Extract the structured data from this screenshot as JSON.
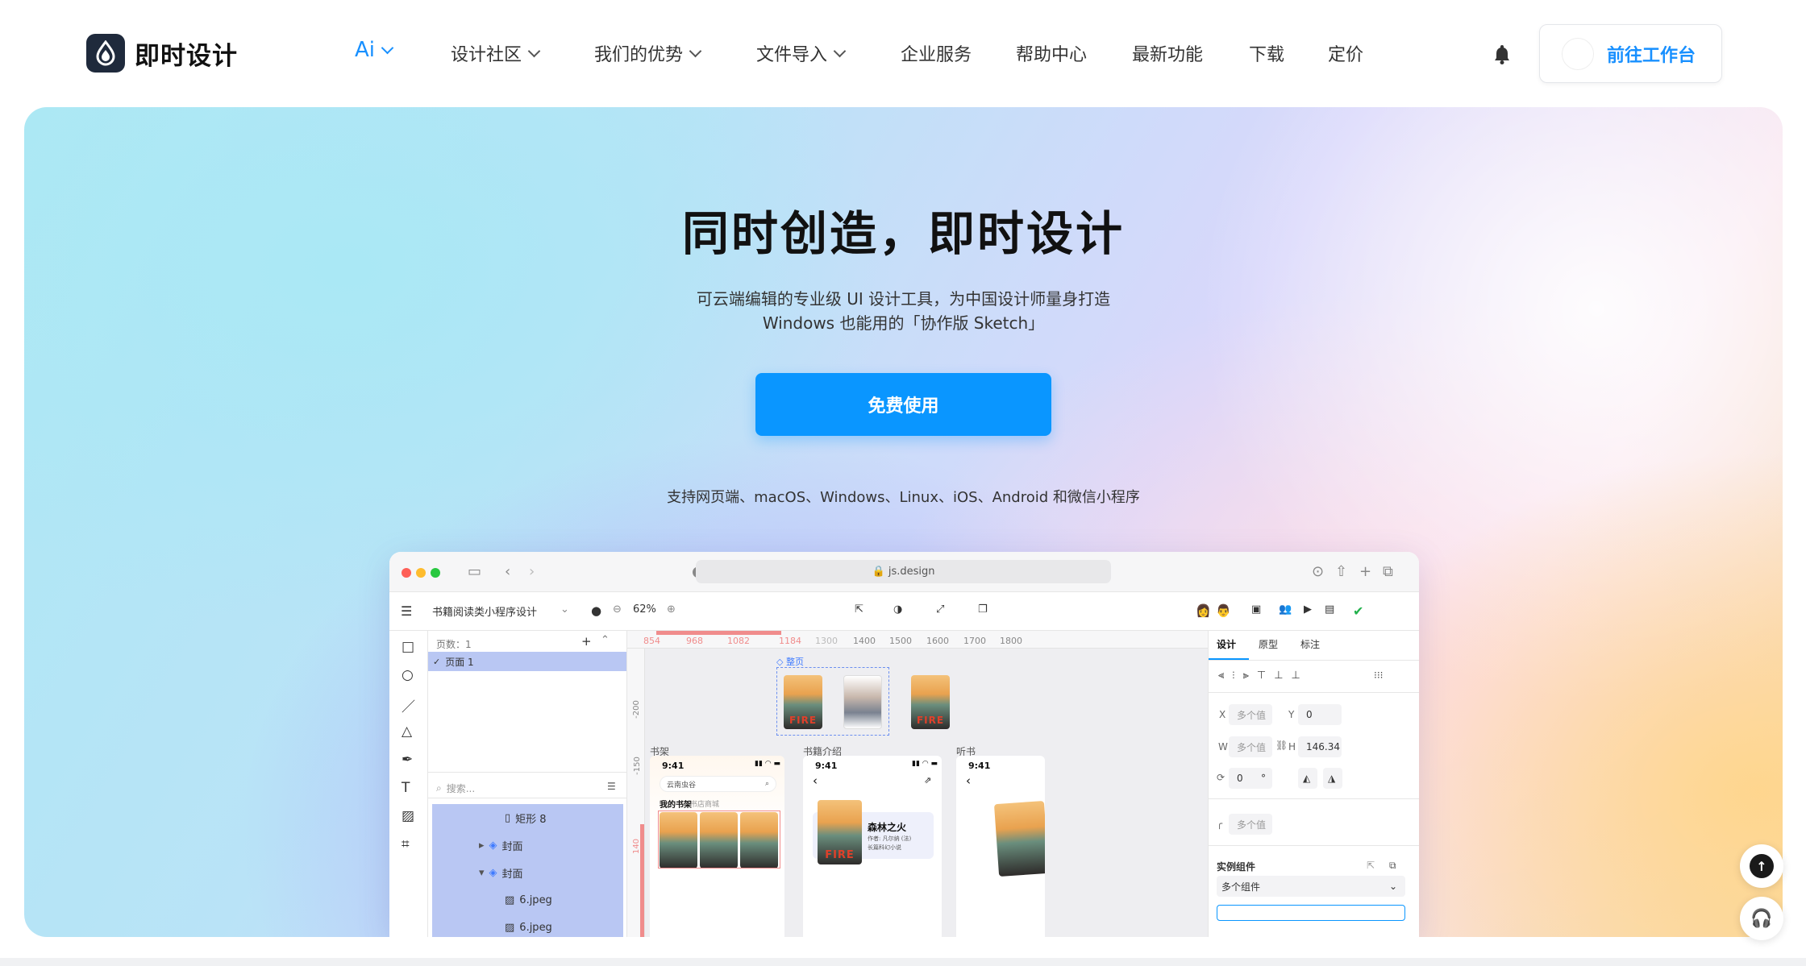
{
  "brand": {
    "name": "即时设计"
  },
  "nav": {
    "items": [
      {
        "label": "Ai",
        "has_dropdown": true
      },
      {
        "label": "设计社区",
        "has_dropdown": true
      },
      {
        "label": "我们的优势",
        "has_dropdown": true
      },
      {
        "label": "文件导入",
        "has_dropdown": true
      },
      {
        "label": "企业服务",
        "has_dropdown": false
      },
      {
        "label": "帮助中心",
        "has_dropdown": false
      },
      {
        "label": "最新功能",
        "has_dropdown": false
      },
      {
        "label": "下载",
        "has_dropdown": false
      },
      {
        "label": "定价",
        "has_dropdown": false
      }
    ],
    "bell_icon": "bell-icon",
    "workbench_label": "前往工作台"
  },
  "hero": {
    "title": "同时创造，即时设计",
    "subtitle_line1": "可云端编辑的专业级 UI 设计工具，为中国设计师量身打造",
    "subtitle_line2": "Windows 也能用的「协作版 Sketch」",
    "cta_label": "免费使用",
    "platforms": "支持网页端、macOS、Windows、Linux、iOS、Android 和微信小程序"
  },
  "app": {
    "url": "js.design",
    "file_name": "书籍阅读类小程序设计",
    "zoom": "62%",
    "pages_label": "页数：1",
    "page_item": "页面 1",
    "search_placeholder": "搜索...",
    "layers": [
      "矩形 8",
      "封面",
      "封面",
      "6.jpeg",
      "6.jpeg"
    ],
    "ruler_top": [
      "854",
      "968",
      "1082",
      "1184",
      "1300",
      "1400",
      "1500",
      "1600",
      "1700",
      "1800"
    ],
    "ruler_left": [
      "-200",
      "-150",
      "140"
    ],
    "frame_label": "整页",
    "boards": [
      "书架",
      "书籍介绍",
      "听书"
    ],
    "phone": {
      "time": "9:41",
      "search_text": "云南虫谷",
      "shelf_tab": "我的书架",
      "store_tab": "书店商城",
      "book_title": "森林之火",
      "book_author": "作者: 凡尔纳 (法)",
      "book_meta": "长篇科幻小说",
      "cover_text": "FIRE",
      "cover_sub": "WRECKS A FOREST"
    },
    "props_tabs": [
      "设计",
      "原型",
      "标注"
    ],
    "props": {
      "x_label": "X",
      "x_value": "多个值",
      "y_label": "Y",
      "y_value": "0",
      "w_label": "W",
      "w_value": "多个值",
      "h_label": "H",
      "h_value": "146.34",
      "rotation": "0",
      "rotation_unit": "°",
      "radius": "多个值",
      "component_title": "实例组件",
      "component_value": "多个组件"
    }
  },
  "colors": {
    "accent": "#0a96ff",
    "brand_dark": "#1f2a3c",
    "selection": "#b9c7f3"
  }
}
